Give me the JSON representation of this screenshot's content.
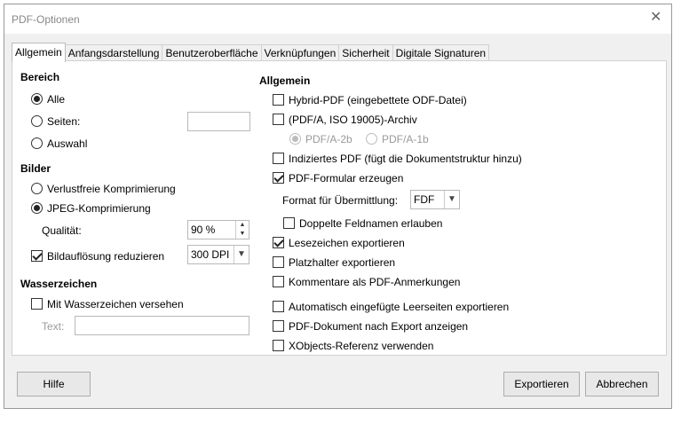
{
  "window": {
    "title": "PDF-Optionen",
    "close_glyph": "✕"
  },
  "tabs": [
    {
      "label": "Allgemein",
      "active": true
    },
    {
      "label": "Anfangsdarstellung"
    },
    {
      "label": "Benutzeroberfläche"
    },
    {
      "label": "Verknüpfungen"
    },
    {
      "label": "Sicherheit"
    },
    {
      "label": "Digitale Signaturen"
    }
  ],
  "left": {
    "bereich": {
      "heading": "Bereich",
      "alle": "Alle",
      "seiten": "Seiten:",
      "seiten_value": "",
      "auswahl": "Auswahl"
    },
    "bilder": {
      "heading": "Bilder",
      "verlustfrei": "Verlustfreie Komprimierung",
      "jpeg": "JPEG-Komprimierung",
      "qualitaet_label": "Qualität:",
      "qualitaet_value": "90 %",
      "bildaufloesung": "Bildauflösung reduzieren",
      "dpi_value": "300 DPI"
    },
    "wasserzeichen": {
      "heading": "Wasserzeichen",
      "mit": "Mit Wasserzeichen versehen",
      "text_label": "Text:",
      "text_value": ""
    }
  },
  "right": {
    "heading": "Allgemein",
    "hybrid": "Hybrid-PDF (eingebettete ODF-Datei)",
    "pdfa": "(PDF/A, ISO 19005)-Archiv",
    "pdfa2b": "PDF/A-2b",
    "pdfa1b": "PDF/A-1b",
    "indiziert": "Indiziertes PDF (fügt die Dokumentstruktur hinzu)",
    "formular": "PDF-Formular erzeugen",
    "format_label": "Format für Übermittlung:",
    "format_value": "FDF",
    "doppelte": "Doppelte Feldnamen erlauben",
    "lesezeichen": "Lesezeichen exportieren",
    "platzhalter": "Platzhalter exportieren",
    "kommentare": "Kommentare als PDF-Anmerkungen",
    "leerseiten": "Automatisch eingefügte Leerseiten exportieren",
    "anzeigen": "PDF-Dokument nach Export anzeigen",
    "xobjects": "XObjects-Referenz verwenden"
  },
  "buttons": {
    "hilfe": "Hilfe",
    "exportieren": "Exportieren",
    "abbrechen": "Abbrechen"
  },
  "icons": {
    "spin_up": "▲",
    "spin_down": "▼",
    "combo_arrow": "▼"
  }
}
